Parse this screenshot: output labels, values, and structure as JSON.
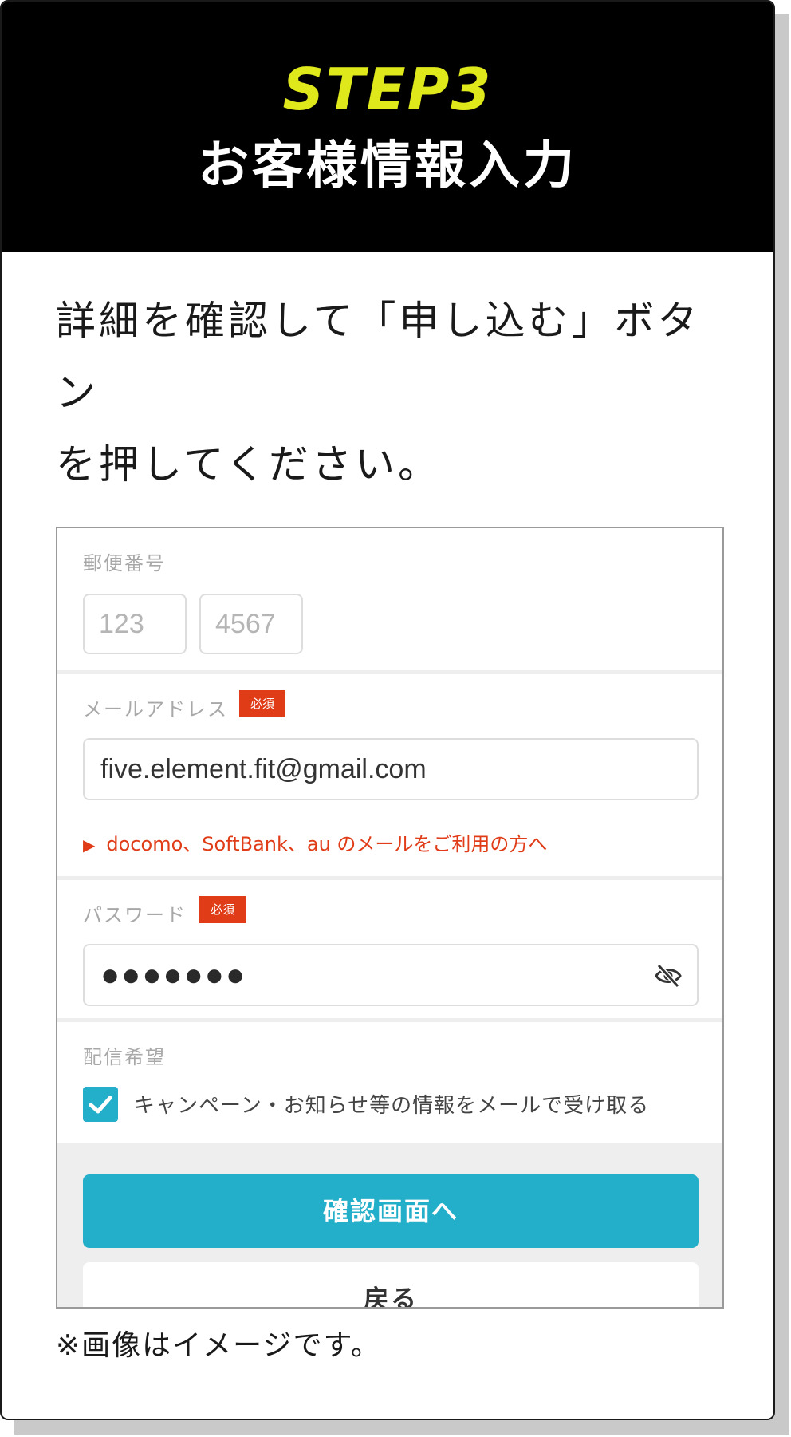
{
  "header": {
    "step": "STEP3",
    "title": "お客様情報入力"
  },
  "instruction": {
    "line1": "詳細を確認して「申し込む」ボタン",
    "line2": "を押してください。"
  },
  "form": {
    "postal": {
      "label": "郵便番号",
      "part1_placeholder": "123",
      "part2_placeholder": "4567"
    },
    "email": {
      "label": "メールアドレス",
      "required_badge": "必須",
      "value": "five.element.fit@gmail.com",
      "carrier_link": "docomo、SoftBank、au のメールをご利用の方へ"
    },
    "password": {
      "label": "パスワード",
      "required_badge": "必須",
      "masked_value": "●●●●●●●",
      "toggle_icon": "eye-slash-icon"
    },
    "newsletter": {
      "label": "配信希望",
      "checkbox_label": "キャンペーン・お知らせ等の情報をメールで受け取る",
      "checked": true
    },
    "buttons": {
      "confirm": "確認画面へ",
      "back": "戻る"
    }
  },
  "note": "※画像はイメージです。",
  "colors": {
    "accent_yellow": "#dfe81a",
    "primary": "#23aec9",
    "required": "#e03c18"
  }
}
